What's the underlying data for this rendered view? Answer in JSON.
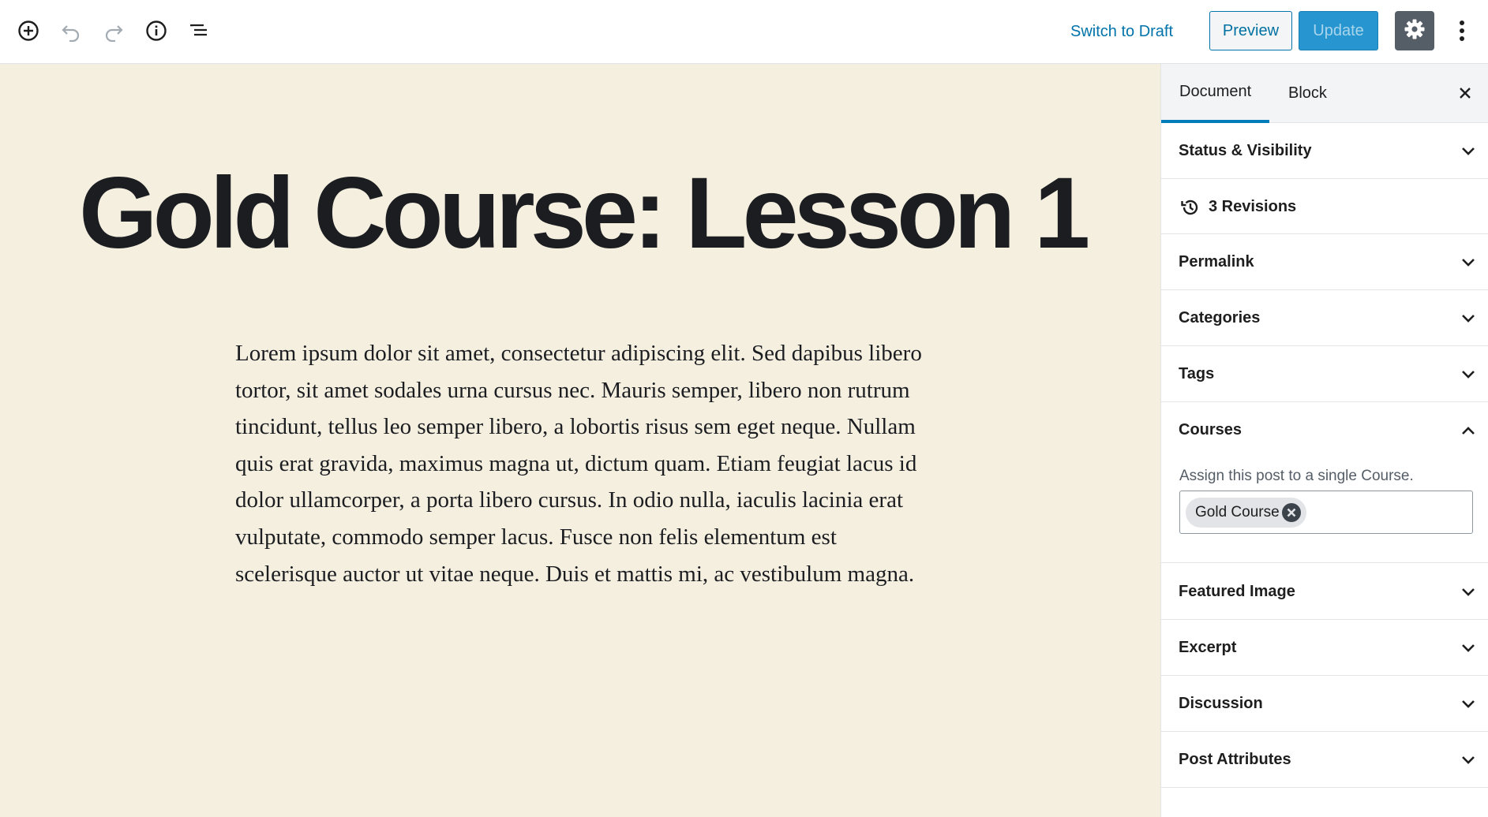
{
  "toolbar": {
    "switch_to_draft": "Switch to Draft",
    "preview": "Preview",
    "update": "Update",
    "icons": [
      "add-block-icon",
      "undo-icon",
      "redo-icon",
      "info-icon",
      "block-navigation-icon",
      "gear-icon",
      "more-options-icon"
    ]
  },
  "post": {
    "title": "Gold Course: Lesson 1",
    "body": "Lorem ipsum dolor sit amet, consectetur adipiscing elit. Sed dapibus libero tortor, sit amet sodales urna cursus nec. Mauris semper, libero non rutrum tincidunt, tellus leo semper libero, a lobortis risus sem eget neque. Nullam quis erat gravida, maximus magna ut, dictum quam. Etiam feugiat lacus id dolor ullamcorper, a porta libero cursus. In odio nulla, iaculis lacinia erat vulputate, commodo semper lacus. Fusce non felis elementum est scelerisque auctor ut vitae neque. Duis et mattis mi, ac vestibulum magna."
  },
  "sidebar": {
    "tabs": {
      "document": "Document",
      "block": "Block"
    },
    "panels": {
      "status": "Status & Visibility",
      "revisions": "3 Revisions",
      "permalink": "Permalink",
      "categories": "Categories",
      "tags": "Tags",
      "courses": "Courses",
      "featured_image": "Featured Image",
      "excerpt": "Excerpt",
      "discussion": "Discussion",
      "post_attributes": "Post Attributes"
    },
    "courses": {
      "help": "Assign this post to a single Course.",
      "selected_token": "Gold Course"
    }
  },
  "colors": {
    "canvas_bg": "#f5efe0",
    "accent": "#0073aa",
    "update_bg": "#2795cf",
    "settings_bg": "#555d66"
  }
}
